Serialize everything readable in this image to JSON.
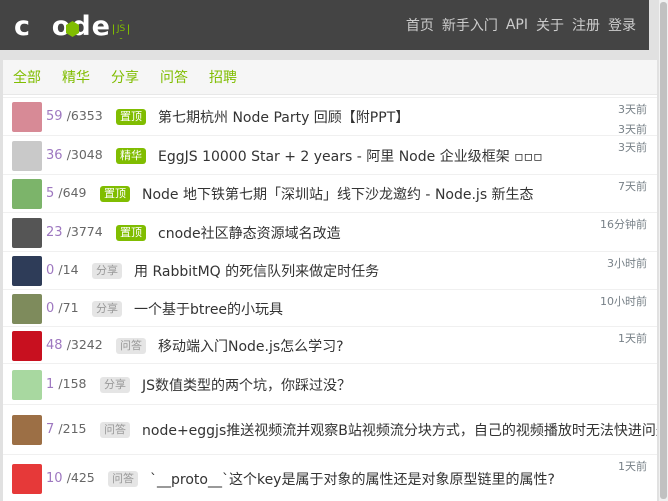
{
  "logo": {
    "text": "cnode",
    "badge": "JS"
  },
  "nav": [
    "首页",
    "新手入门",
    "API",
    "关于",
    "注册",
    "登录"
  ],
  "tabs": [
    "全部",
    "精华",
    "分享",
    "问答",
    "招聘"
  ],
  "topics": [
    {
      "reply": "59",
      "visit": "/6353",
      "tag": "置顶",
      "tag_style": "put-top",
      "title": "第七期杭州 Node Party 回顾【附PPT】",
      "time": [
        "3天前",
        "3天前"
      ],
      "avatar_color": "#d78a96"
    },
    {
      "reply": "36",
      "visit": "/3048",
      "tag": "精华",
      "tag_style": "put-top",
      "title": "EggJS 10000 Star + 2 years - 阿里 Node 企业级框架 ▫▫▫",
      "time": [
        "3天前"
      ],
      "avatar_color": "#c9c9c9"
    },
    {
      "reply": "5",
      "visit": "/649",
      "tag": "置顶",
      "tag_style": "put-top",
      "title": "Node 地下铁第七期「深圳站」线下沙龙邀约 - Node.js 新生态",
      "time": [
        "7天前"
      ],
      "avatar_color": "#7cb46a"
    },
    {
      "reply": "23",
      "visit": "/3774",
      "tag": "置顶",
      "tag_style": "put-top",
      "title": "cnode社区静态资源域名改造",
      "time": [
        "16分钟前"
      ],
      "avatar_color": "#555555"
    },
    {
      "reply": "0",
      "visit": "/14",
      "tag": "分享",
      "tag_style": "gray",
      "title": "用 RabbitMQ 的死信队列来做定时任务",
      "time": [
        "3小时前"
      ],
      "avatar_color": "#2e3c58"
    },
    {
      "reply": "0",
      "visit": "/71",
      "tag": "分享",
      "tag_style": "gray",
      "title": "一个基于btree的小玩具",
      "time": [
        "10小时前"
      ],
      "avatar_color": "#7e8b5c"
    },
    {
      "reply": "48",
      "visit": "/3242",
      "tag": "问答",
      "tag_style": "gray",
      "title": "移动端入门Node.js怎么学习?",
      "time": [
        "1天前"
      ],
      "avatar_color": "#c8101f"
    },
    {
      "reply": "1",
      "visit": "/158",
      "tag": "分享",
      "tag_style": "gray",
      "title": "JS数值类型的两个坑，你踩过没？",
      "time": [
        ""
      ],
      "avatar_color": "#a8d8a0"
    },
    {
      "reply": "7",
      "visit": "/215",
      "tag": "问答",
      "tag_style": "gray",
      "title": "node+eggjs推送视频流并观察B站视频流分块方式，自己的视频播放时无法快进问题？",
      "time": [
        ""
      ],
      "avatar_color": "#9c6f45"
    },
    {
      "reply": "10",
      "visit": "/425",
      "tag": "问答",
      "tag_style": "gray",
      "title": "`__proto__`这个key是属于对象的属性还是对象原型链里的属性?",
      "time": [
        "1天前"
      ],
      "avatar_color": "#e63939"
    }
  ]
}
